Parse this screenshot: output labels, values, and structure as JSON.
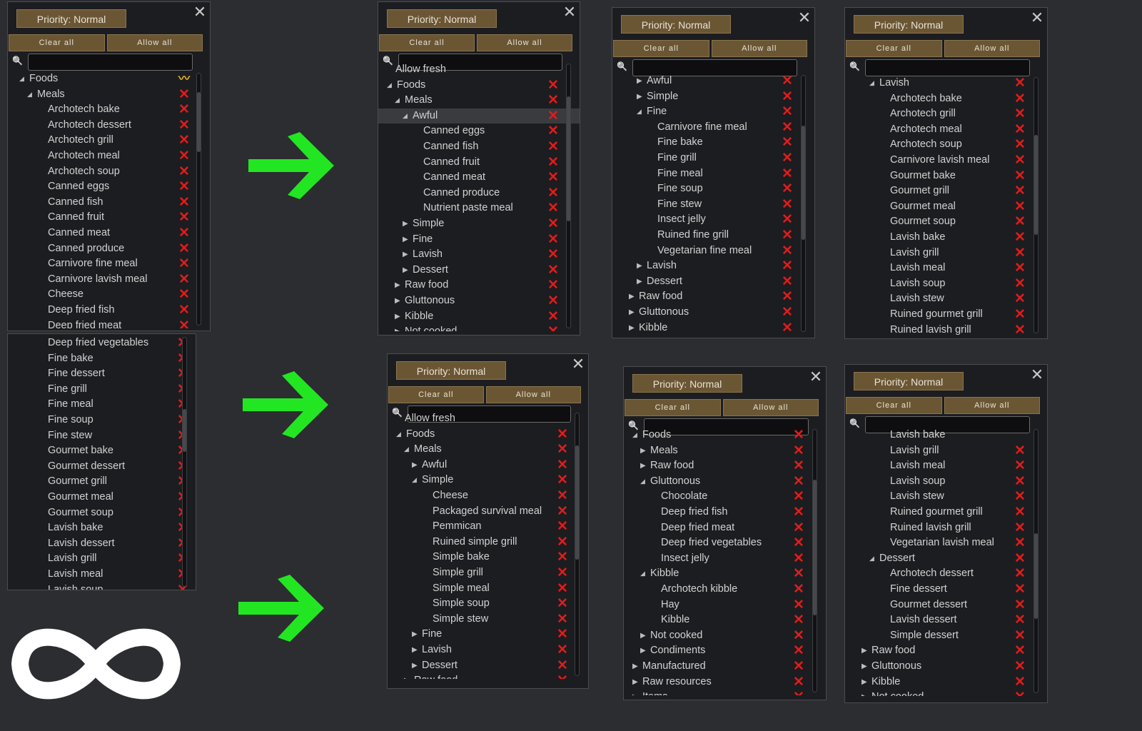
{
  "common": {
    "priority": "Priority: Normal",
    "clear_all": "Clear all",
    "allow_all": "Allow all"
  },
  "panels": [
    {
      "rows": [
        [
          "Foods",
          0,
          "exp",
          "p"
        ],
        [
          "Meals",
          1,
          "exp",
          "x"
        ],
        [
          "Archotech bake",
          2,
          "",
          "x"
        ],
        [
          "Archotech dessert",
          2,
          "",
          "x"
        ],
        [
          "Archotech grill",
          2,
          "",
          "x"
        ],
        [
          "Archotech meal",
          2,
          "",
          "x"
        ],
        [
          "Archotech soup",
          2,
          "",
          "x"
        ],
        [
          "Canned eggs",
          2,
          "",
          "x"
        ],
        [
          "Canned fish",
          2,
          "",
          "x"
        ],
        [
          "Canned fruit",
          2,
          "",
          "x"
        ],
        [
          "Canned meat",
          2,
          "",
          "x"
        ],
        [
          "Canned produce",
          2,
          "",
          "x"
        ],
        [
          "Carnivore fine meal",
          2,
          "",
          "x"
        ],
        [
          "Carnivore lavish meal",
          2,
          "",
          "x"
        ],
        [
          "Cheese",
          2,
          "",
          "x"
        ],
        [
          "Deep fried fish",
          2,
          "",
          "x"
        ],
        [
          "Deep fried meat",
          2,
          "",
          "x"
        ]
      ]
    },
    {
      "rows": [
        [
          "Deep fried vegetables",
          2,
          "",
          "x"
        ],
        [
          "Fine bake",
          2,
          "",
          "x"
        ],
        [
          "Fine dessert",
          2,
          "",
          "x"
        ],
        [
          "Fine grill",
          2,
          "",
          "x"
        ],
        [
          "Fine meal",
          2,
          "",
          "x"
        ],
        [
          "Fine soup",
          2,
          "",
          "x"
        ],
        [
          "Fine stew",
          2,
          "",
          "x"
        ],
        [
          "Gourmet bake",
          2,
          "",
          "x"
        ],
        [
          "Gourmet dessert",
          2,
          "",
          "x"
        ],
        [
          "Gourmet grill",
          2,
          "",
          "x"
        ],
        [
          "Gourmet meal",
          2,
          "",
          "x"
        ],
        [
          "Gourmet soup",
          2,
          "",
          "x"
        ],
        [
          "Lavish bake",
          2,
          "",
          "x"
        ],
        [
          "Lavish dessert",
          2,
          "",
          "x"
        ],
        [
          "Lavish grill",
          2,
          "",
          "x"
        ],
        [
          "Lavish meal",
          2,
          "",
          "x"
        ],
        [
          "Lavish soup",
          2,
          "",
          "x"
        ]
      ]
    },
    {
      "rows": [
        [
          "Allow fresh",
          0,
          "",
          ""
        ],
        [
          "Foods",
          0,
          "exp",
          "x"
        ],
        [
          "Meals",
          1,
          "exp",
          "x"
        ],
        [
          "Awful",
          2,
          "exp",
          "x"
        ],
        [
          "Canned eggs",
          3,
          "",
          "x"
        ],
        [
          "Canned fish",
          3,
          "",
          "x"
        ],
        [
          "Canned fruit",
          3,
          "",
          "x"
        ],
        [
          "Canned meat",
          3,
          "",
          "x"
        ],
        [
          "Canned produce",
          3,
          "",
          "x"
        ],
        [
          "Nutrient paste meal",
          3,
          "",
          "x"
        ],
        [
          "Simple",
          2,
          "col",
          "x"
        ],
        [
          "Fine",
          2,
          "col",
          "x"
        ],
        [
          "Lavish",
          2,
          "col",
          "x"
        ],
        [
          "Dessert",
          2,
          "col",
          "x"
        ],
        [
          "Raw food",
          1,
          "col",
          "x"
        ],
        [
          "Gluttonous",
          1,
          "col",
          "x"
        ],
        [
          "Kibble",
          1,
          "col",
          "x"
        ],
        [
          "Not cooked",
          1,
          "col",
          "x"
        ]
      ]
    },
    {
      "rows": [
        [
          "Allow fresh",
          0,
          "",
          ""
        ],
        [
          "Foods",
          0,
          "exp",
          "x"
        ],
        [
          "Meals",
          1,
          "exp",
          "x"
        ],
        [
          "Awful",
          2,
          "col",
          "x"
        ],
        [
          "Simple",
          2,
          "exp",
          "x"
        ],
        [
          "Cheese",
          3,
          "",
          "x"
        ],
        [
          "Packaged survival meal",
          3,
          "",
          "x"
        ],
        [
          "Pemmican",
          3,
          "",
          "x"
        ],
        [
          "Ruined simple grill",
          3,
          "",
          "x"
        ],
        [
          "Simple bake",
          3,
          "",
          "x"
        ],
        [
          "Simple grill",
          3,
          "",
          "x"
        ],
        [
          "Simple meal",
          3,
          "",
          "x"
        ],
        [
          "Simple soup",
          3,
          "",
          "x"
        ],
        [
          "Simple stew",
          3,
          "",
          "x"
        ],
        [
          "Fine",
          2,
          "col",
          "x"
        ],
        [
          "Lavish",
          2,
          "col",
          "x"
        ],
        [
          "Dessert",
          2,
          "col",
          "x"
        ],
        [
          "Raw food",
          1,
          "col",
          "x"
        ]
      ]
    },
    {
      "rows": [
        [
          "Awful",
          2,
          "col",
          "x"
        ],
        [
          "Simple",
          2,
          "col",
          "x"
        ],
        [
          "Fine",
          2,
          "exp",
          "x"
        ],
        [
          "Carnivore fine meal",
          3,
          "",
          "x"
        ],
        [
          "Fine bake",
          3,
          "",
          "x"
        ],
        [
          "Fine grill",
          3,
          "",
          "x"
        ],
        [
          "Fine meal",
          3,
          "",
          "x"
        ],
        [
          "Fine soup",
          3,
          "",
          "x"
        ],
        [
          "Fine stew",
          3,
          "",
          "x"
        ],
        [
          "Insect jelly",
          3,
          "",
          "x"
        ],
        [
          "Ruined fine grill",
          3,
          "",
          "x"
        ],
        [
          "Vegetarian fine meal",
          3,
          "",
          "x"
        ],
        [
          "Lavish",
          2,
          "col",
          "x"
        ],
        [
          "Dessert",
          2,
          "col",
          "x"
        ],
        [
          "Raw food",
          1,
          "col",
          "x"
        ],
        [
          "Gluttonous",
          1,
          "col",
          "x"
        ],
        [
          "Kibble",
          1,
          "col",
          "x"
        ]
      ]
    },
    {
      "rows": [
        [
          "Foods",
          0,
          "exp",
          "x"
        ],
        [
          "Meals",
          1,
          "col",
          "x"
        ],
        [
          "Raw food",
          1,
          "col",
          "x"
        ],
        [
          "Gluttonous",
          1,
          "exp",
          "x"
        ],
        [
          "Chocolate",
          2,
          "",
          "x"
        ],
        [
          "Deep fried fish",
          2,
          "",
          "x"
        ],
        [
          "Deep fried meat",
          2,
          "",
          "x"
        ],
        [
          "Deep fried vegetables",
          2,
          "",
          "x"
        ],
        [
          "Insect jelly",
          2,
          "",
          "x"
        ],
        [
          "Kibble",
          1,
          "exp",
          "x"
        ],
        [
          "Archotech kibble",
          2,
          "",
          "x"
        ],
        [
          "Hay",
          2,
          "",
          "x"
        ],
        [
          "Kibble",
          2,
          "",
          "x"
        ],
        [
          "Not cooked",
          1,
          "col",
          "x"
        ],
        [
          "Condiments",
          1,
          "col",
          "x"
        ],
        [
          "Manufactured",
          0,
          "col",
          "x"
        ],
        [
          "Raw resources",
          0,
          "col",
          "x"
        ],
        [
          "Items",
          0,
          "col",
          "x"
        ]
      ]
    },
    {
      "rows": [
        [
          "Lavish",
          2,
          "exp",
          "x"
        ],
        [
          "Archotech bake",
          3,
          "",
          "x"
        ],
        [
          "Archotech grill",
          3,
          "",
          "x"
        ],
        [
          "Archotech meal",
          3,
          "",
          "x"
        ],
        [
          "Archotech soup",
          3,
          "",
          "x"
        ],
        [
          "Carnivore lavish meal",
          3,
          "",
          "x"
        ],
        [
          "Gourmet bake",
          3,
          "",
          "x"
        ],
        [
          "Gourmet grill",
          3,
          "",
          "x"
        ],
        [
          "Gourmet meal",
          3,
          "",
          "x"
        ],
        [
          "Gourmet soup",
          3,
          "",
          "x"
        ],
        [
          "Lavish bake",
          3,
          "",
          "x"
        ],
        [
          "Lavish grill",
          3,
          "",
          "x"
        ],
        [
          "Lavish meal",
          3,
          "",
          "x"
        ],
        [
          "Lavish soup",
          3,
          "",
          "x"
        ],
        [
          "Lavish stew",
          3,
          "",
          "x"
        ],
        [
          "Ruined gourmet grill",
          3,
          "",
          "x"
        ],
        [
          "Ruined lavish grill",
          3,
          "",
          "x"
        ]
      ]
    },
    {
      "rows": [
        [
          "Lavish bake",
          3,
          "",
          ""
        ],
        [
          "Lavish grill",
          3,
          "",
          "x"
        ],
        [
          "Lavish meal",
          3,
          "",
          "x"
        ],
        [
          "Lavish soup",
          3,
          "",
          "x"
        ],
        [
          "Lavish stew",
          3,
          "",
          "x"
        ],
        [
          "Ruined gourmet grill",
          3,
          "",
          "x"
        ],
        [
          "Ruined lavish grill",
          3,
          "",
          "x"
        ],
        [
          "Vegetarian lavish meal",
          3,
          "",
          "x"
        ],
        [
          "Dessert",
          2,
          "exp",
          "x"
        ],
        [
          "Archotech dessert",
          3,
          "",
          "x"
        ],
        [
          "Fine dessert",
          3,
          "",
          "x"
        ],
        [
          "Gourmet dessert",
          3,
          "",
          "x"
        ],
        [
          "Lavish dessert",
          3,
          "",
          "x"
        ],
        [
          "Simple dessert",
          3,
          "",
          "x"
        ],
        [
          "Raw food",
          1,
          "col",
          "x"
        ],
        [
          "Gluttonous",
          1,
          "col",
          "x"
        ],
        [
          "Kibble",
          1,
          "col",
          "x"
        ],
        [
          "Not cooked",
          1,
          "col",
          "x"
        ]
      ]
    }
  ],
  "icons": {
    "close": "close-icon",
    "search": "search-icon",
    "arrow": "green-right-arrow",
    "infinity": "infinity-symbol",
    "expanded": "triangle-expanded-icon",
    "collapsed": "triangle-collapsed-icon",
    "disallow": "red-x-icon",
    "partial": "partial-tilde-icon"
  },
  "colors": {
    "arrow": "#22e622",
    "disallow": "#e01c1c",
    "partial": "#e2b32c",
    "button": "#6b5634"
  },
  "highlighted_row": "Awful"
}
